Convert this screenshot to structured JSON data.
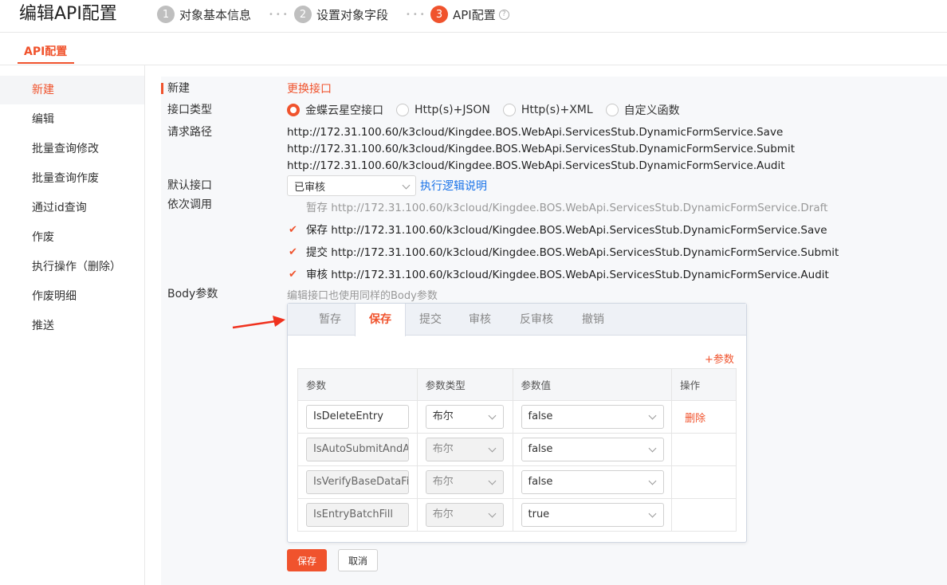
{
  "header": {
    "title": "编辑API配置",
    "steps": [
      {
        "num": "1",
        "label": "对象基本信息"
      },
      {
        "num": "2",
        "label": "设置对象字段"
      },
      {
        "num": "3",
        "label": "API配置"
      }
    ]
  },
  "main_tab": "API配置",
  "sidebar": {
    "items": [
      "新建",
      "编辑",
      "批量查询修改",
      "批量查询作废",
      "通过id查询",
      "作废",
      "执行操作（删除）",
      "作废明细",
      "推送"
    ]
  },
  "form": {
    "section_title": "新建",
    "change_link": "更换接口",
    "interface_type_label": "接口类型",
    "interface_types": [
      "金蝶云星空接口",
      "Http(s)+JSON",
      "Http(s)+XML",
      "自定义函数"
    ],
    "request_path_label": "请求路径",
    "request_paths": [
      "http://172.31.100.60/k3cloud/Kingdee.BOS.WebApi.ServicesStub.DynamicFormService.Save",
      "http://172.31.100.60/k3cloud/Kingdee.BOS.WebApi.ServicesStub.DynamicFormService.Submit",
      "http://172.31.100.60/k3cloud/Kingdee.BOS.WebApi.ServicesStub.DynamicFormService.Audit"
    ],
    "default_interface_label": "默认接口",
    "default_interface_value": "已审核",
    "logic_link": "执行逻辑说明",
    "sequence_label": "依次调用",
    "sequence": [
      {
        "name": "暂存",
        "url": "http://172.31.100.60/k3cloud/Kingdee.BOS.WebApi.ServicesStub.DynamicFormService.Draft"
      },
      {
        "name": "保存",
        "url": "http://172.31.100.60/k3cloud/Kingdee.BOS.WebApi.ServicesStub.DynamicFormService.Save"
      },
      {
        "name": "提交",
        "url": "http://172.31.100.60/k3cloud/Kingdee.BOS.WebApi.ServicesStub.DynamicFormService.Submit"
      },
      {
        "name": "审核",
        "url": "http://172.31.100.60/k3cloud/Kingdee.BOS.WebApi.ServicesStub.DynamicFormService.Audit"
      }
    ],
    "body_label": "Body参数",
    "body_hint": "编辑接口也使用同样的Body参数"
  },
  "body_tabs": [
    "暂存",
    "保存",
    "提交",
    "审核",
    "反审核",
    "撤销"
  ],
  "add_param": "+参数",
  "param_table": {
    "headers": [
      "参数",
      "参数类型",
      "参数值",
      "操作"
    ],
    "rows": [
      {
        "param": "IsDeleteEntry",
        "type": "布尔",
        "value": "false",
        "action": "删除"
      },
      {
        "param": "IsAutoSubmitAndAudit",
        "type": "布尔",
        "value": "false",
        "action": ""
      },
      {
        "param": "IsVerifyBaseDataField",
        "type": "布尔",
        "value": "false",
        "action": ""
      },
      {
        "param": "IsEntryBatchFill",
        "type": "布尔",
        "value": "true",
        "action": ""
      }
    ]
  },
  "buttons": {
    "save": "保存",
    "cancel": "取消"
  },
  "colors": {
    "accent": "#f0532d",
    "link": "#1a73e8"
  }
}
